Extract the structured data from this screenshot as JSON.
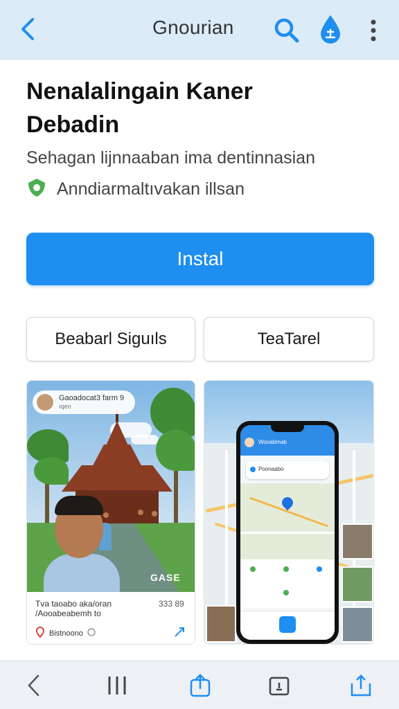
{
  "topbar": {
    "title": "Gnourian",
    "icons": [
      "back-arrow-icon",
      "search-icon",
      "water-drop-icon",
      "more-vertical-icon"
    ],
    "accent": "#1e8ef0",
    "background": "#dcebf8"
  },
  "app": {
    "title": "Nenalalingain Kaner Debadin",
    "subtitle": "Sehagan lijnnaaban ima dentinnasian",
    "verified_text": "Anndiarmaltıvakan illsan",
    "verified_icon": "verified-shield-icon",
    "verified_color": "#4caf50"
  },
  "actions": {
    "install_label": "Instal",
    "install_color": "#1e8ef0",
    "secondary_left": "Beabarl Siguıls",
    "secondary_right": "TeaTarel"
  },
  "screenshots": [
    {
      "chip_line1": "Gaoadocat3 farm 9",
      "chip_line2": "ıqeo",
      "watermark": "GASE",
      "caption_line1": "Tva taoabo aka/oran",
      "caption_line2": "/Aooabeabemh to",
      "count": "333 89",
      "location_text": "Bistnoono"
    },
    {
      "header_text": "Wooabmab",
      "card_text": "Poonaabo"
    }
  ],
  "bottombar": {
    "icons": [
      "back-chevron-icon",
      "recents-icon",
      "share-icon",
      "tabs-icon",
      "upload-icon"
    ]
  }
}
